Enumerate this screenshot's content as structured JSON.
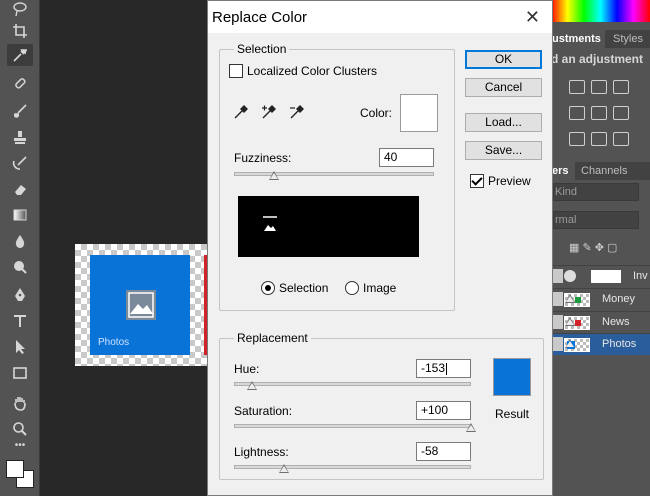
{
  "canvas": {
    "doc_label": "Photos",
    "tile_color": "#0a73d8"
  },
  "right_panels": {
    "adjust_tabs": [
      "ustments",
      "Styles"
    ],
    "adjust_hint": "d an adjustment",
    "layer_tabs": [
      "ers",
      "Channels"
    ],
    "filter_kind": "Kind",
    "blend_mode": "rmal",
    "layers": [
      {
        "name": "Inv",
        "selected": false
      },
      {
        "name": "Money",
        "selected": false
      },
      {
        "name": "News",
        "selected": false
      },
      {
        "name": "Photos",
        "selected": true
      }
    ]
  },
  "dialog": {
    "title": "Replace Color",
    "close_glyph": "✕",
    "buttons": {
      "ok": "OK",
      "cancel": "Cancel",
      "load": "Load...",
      "save": "Save..."
    },
    "preview": {
      "label": "Preview",
      "checked": true
    },
    "selection": {
      "group_title": "Selection",
      "localized_label": "Localized Color Clusters",
      "localized_checked": false,
      "color_label": "Color:",
      "color_value": "#ffffff",
      "fuzziness_label": "Fuzziness:",
      "fuzziness_value": "40",
      "fuzziness_level": 0.2,
      "view_selection": "Selection",
      "view_image": "Image",
      "view_selected": "selection"
    },
    "replacement": {
      "group_title": "Replacement",
      "hue_label": "Hue:",
      "hue_value": "-153",
      "hue_level": 0.075,
      "saturation_label": "Saturation:",
      "saturation_value": "+100",
      "saturation_level": 1.0,
      "lightness_label": "Lightness:",
      "lightness_value": "-58",
      "lightness_level": 0.21,
      "result_label": "Result",
      "result_color": "#0a73d8"
    }
  }
}
